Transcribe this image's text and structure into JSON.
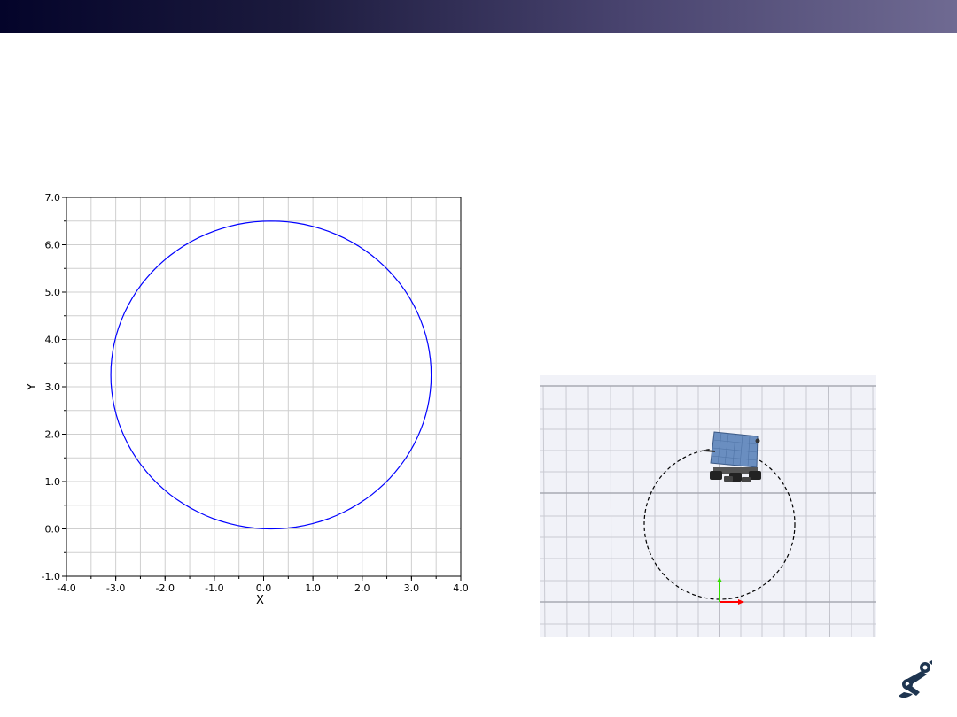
{
  "slide": {
    "topbar_gradient": [
      "#04042a",
      "#1b1a3d",
      "#48436e",
      "#6f6a92"
    ]
  },
  "chart_data": {
    "type": "line",
    "title": "",
    "xlabel": "X",
    "ylabel": "Y",
    "xlim": [
      -4.0,
      4.0
    ],
    "ylim": [
      -1.0,
      7.0
    ],
    "x_ticks": [
      "-4.0",
      "-3.0",
      "-2.0",
      "-1.0",
      "0.0",
      "1.0",
      "2.0",
      "3.0",
      "4.0"
    ],
    "y_ticks": [
      "-1.0",
      "0.0",
      "1.0",
      "2.0",
      "3.0",
      "4.0",
      "5.0",
      "6.0",
      "7.0"
    ],
    "grid": true,
    "series": [
      {
        "color": "#0000ff",
        "shape": "circle trajectory",
        "center": [
          0.15,
          3.25
        ],
        "radius_x": 3.25,
        "radius_y": 3.25,
        "x_range": [
          -3.1,
          3.4
        ],
        "y_range": [
          0.0,
          6.5
        ]
      }
    ]
  },
  "simulation_view": {
    "background": "#f1f2f8",
    "grid_color": "#c8c8d0",
    "path_style": "dashed circle",
    "robot": "mobile robot with solar panel",
    "axis_colors": {
      "x": "#ff0000",
      "y": "#33dd00"
    }
  },
  "logo": {
    "icon": "robot-arm-icon",
    "color": "#1e3550"
  }
}
